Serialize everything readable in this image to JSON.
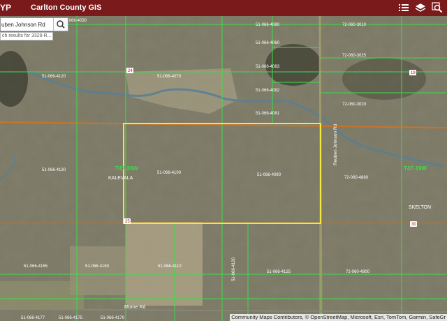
{
  "header": {
    "logo": "YP",
    "title": "Carlton County GIS",
    "icons": [
      "list-icon",
      "layers-icon",
      "zoom-search-icon"
    ]
  },
  "search": {
    "value": "uben Johnson Rd",
    "suggestion": "ch results for 3329 R..."
  },
  "attribution": "Community Maps Contributors, © OpenStreetMap, Microsoft, Esri, TomTom, Garmin, SafeGr",
  "map": {
    "highlight_color": "#f2e93b",
    "parcel_line_color": "#3fdc4a",
    "township_line_color": "#c9742a",
    "parcel_labels": [
      "51-066-4120",
      "51-066-4070",
      "51-066-4080",
      "51-066-4060",
      "51-066-4083",
      "51-066-4082",
      "51-066-4081",
      "51-066-4130",
      "51-066-4100",
      "51-066-4090",
      "72-060-3010",
      "72-060-3025",
      "72-060-3020",
      "72-060-4880",
      "51-066-4160",
      "51-066-4110",
      "51-066-4120",
      "51-066-4125",
      "72-060-4900",
      "51-066-4165",
      "51-066-4177",
      "51-066-4175",
      "51-066-4170"
    ],
    "place_labels": [
      "KALEVALA",
      "SKELTON"
    ],
    "township_labels": [
      "T47-20W",
      "T47-19W"
    ],
    "road_shields": [
      "24",
      "19",
      "25",
      "30"
    ],
    "road_labels": [
      "Reuben Johnson Rd",
      "Mome Rd"
    ],
    "zoom_label_top": "51-066-4030"
  }
}
